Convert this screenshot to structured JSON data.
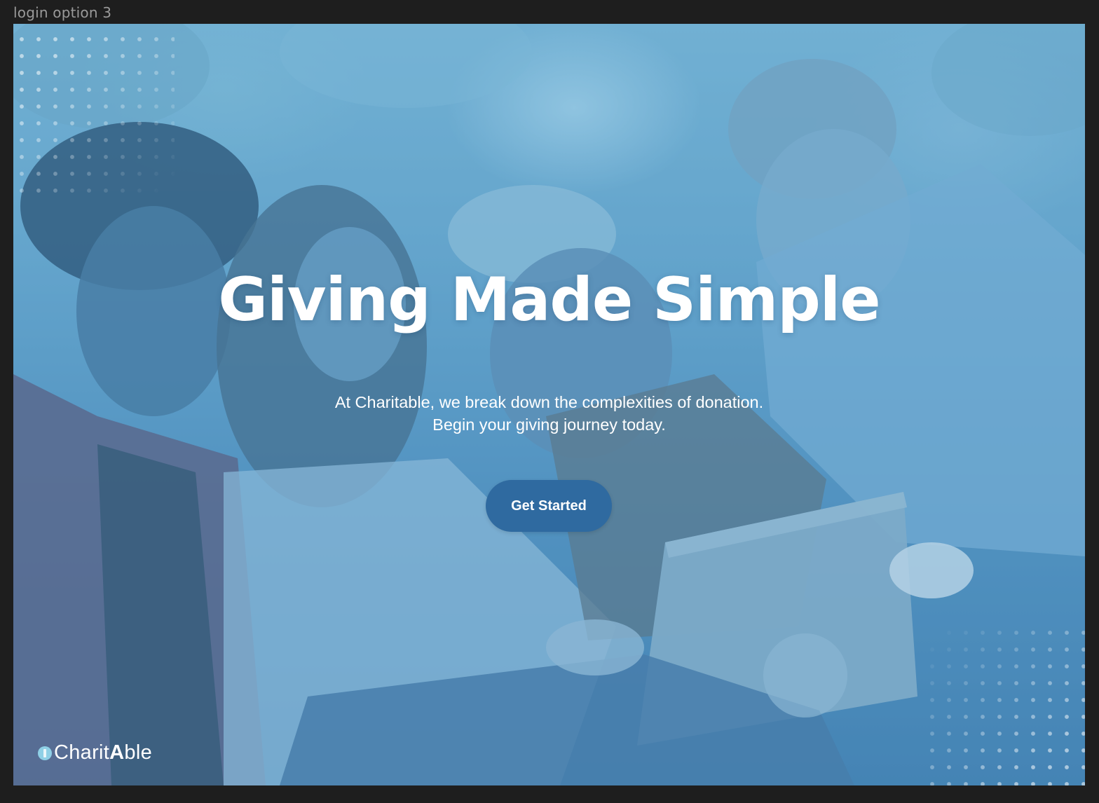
{
  "frame": {
    "label": "login option 3"
  },
  "hero": {
    "headline": "Giving Made Simple",
    "subtext_line1": "At Charitable, we break down the complexities of donation.",
    "subtext_line2": "Begin your giving journey today.",
    "cta_label": "Get Started"
  },
  "logo": {
    "text_part1": "Charit",
    "text_part2": "A",
    "text_part3": "ble",
    "icon": "ribbon-icon"
  },
  "colors": {
    "cta_background": "#2f6aa0",
    "overlay_tint": "#5a9cc8",
    "text": "#ffffff"
  }
}
